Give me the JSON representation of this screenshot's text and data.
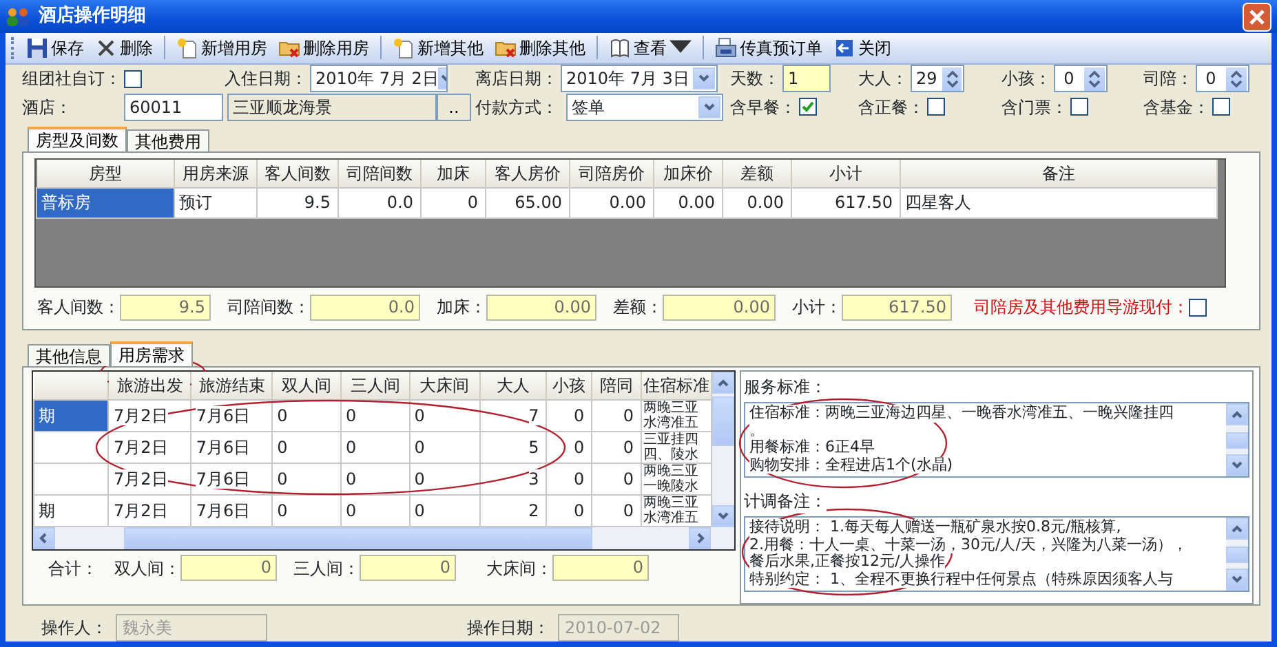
{
  "window": {
    "title": "酒店操作明细"
  },
  "toolbar": [
    [
      {
        "kind": "save",
        "label": "保存"
      },
      {
        "kind": "delete",
        "label": "删除"
      }
    ],
    [
      {
        "kind": "new",
        "label": "新增用房"
      },
      {
        "kind": "remove",
        "label": "删除用房"
      }
    ],
    [
      {
        "kind": "new",
        "label": "新增其他"
      },
      {
        "kind": "remove",
        "label": "删除其他"
      }
    ],
    [
      {
        "kind": "menu",
        "label": "查看"
      }
    ],
    [
      {
        "kind": "fax",
        "label": "传真预订单"
      },
      {
        "kind": "close",
        "label": "关闭"
      }
    ]
  ],
  "form_rows": [
    [
      {
        "kind": "checkbox",
        "label": "组团社自订：",
        "checked": false
      },
      {
        "kind": "date",
        "label": "入住日期：",
        "value": "2010年 7月 2日"
      },
      {
        "kind": "date",
        "label": "离店日期：",
        "value": "2010年 7月 3日"
      },
      {
        "kind": "yellow",
        "label": "天数：",
        "value": "1"
      },
      {
        "kind": "spin",
        "label": "大人：",
        "value": "29"
      },
      {
        "kind": "spin",
        "label": "小孩：",
        "value": "0"
      },
      {
        "kind": "spin",
        "label": "司陪：",
        "value": "0"
      }
    ],
    [
      {
        "kind": "lookup",
        "label": "酒店：",
        "value": "60011",
        "name": "三亚顺龙海景",
        "button": ".."
      },
      {
        "kind": "select",
        "label": "付款方式：",
        "value": "签单"
      },
      {
        "kind": "checkbox",
        "label": "含早餐：",
        "checked": true
      },
      {
        "kind": "checkbox",
        "label": "含正餐：",
        "checked": false
      },
      {
        "kind": "checkbox",
        "label": "含门票：",
        "checked": false
      },
      {
        "kind": "checkbox",
        "label": "含基金：",
        "checked": false
      }
    ]
  ],
  "upper_tabs": [
    {
      "label": "房型及间数",
      "selected": true
    },
    {
      "label": "其他费用",
      "selected": false
    }
  ],
  "rooms_table": {
    "columns": [
      {
        "label": "房型",
        "kind": "text"
      },
      {
        "label": "用房来源",
        "kind": "text"
      },
      {
        "label": "客人间数",
        "kind": "number"
      },
      {
        "label": "司陪间数",
        "kind": "number"
      },
      {
        "label": "加床",
        "kind": "number"
      },
      {
        "label": "客人房价",
        "kind": "number"
      },
      {
        "label": "司陪房价",
        "kind": "number"
      },
      {
        "label": "加床价",
        "kind": "number"
      },
      {
        "label": "差额",
        "kind": "number"
      },
      {
        "label": "小计",
        "kind": "number"
      },
      {
        "label": "备注",
        "kind": "text"
      }
    ],
    "rows": [
      {
        "selected": true,
        "cells": [
          "普标房",
          "预订",
          "9.5",
          "0.0",
          "0",
          "65.00",
          "0.00",
          "0.00",
          "0.00",
          "617.50",
          "四星客人"
        ]
      }
    ]
  },
  "room_summary": {
    "fields": [
      {
        "label": "客人间数：",
        "value": "9.5"
      },
      {
        "label": "司陪间数：",
        "value": "0.0"
      },
      {
        "label": "加床：",
        "value": "0.00"
      },
      {
        "label": "差额：",
        "value": "0.00"
      },
      {
        "label": "小计：",
        "value": "617.50"
      }
    ],
    "guide_pays": {
      "label": "司陪房及其他费用导游现付：",
      "checked": false
    }
  },
  "lower_tabs": [
    {
      "label": "其他信息",
      "selected": false
    },
    {
      "label": "用房需求",
      "selected": true
    }
  ],
  "demand_table": {
    "columns": [
      {
        "label": "旅游出发",
        "kind": "text"
      },
      {
        "label": "旅游结束",
        "kind": "text"
      },
      {
        "label": "双人间",
        "kind": "text"
      },
      {
        "label": "三人间",
        "kind": "text"
      },
      {
        "label": "大床间",
        "kind": "text"
      },
      {
        "label": "大人",
        "kind": "number"
      },
      {
        "label": "小孩",
        "kind": "number"
      },
      {
        "label": "陪同",
        "kind": "number"
      },
      {
        "label": "住宿标准",
        "kind": "wrap"
      }
    ],
    "rows": [
      {
        "selected": true,
        "row_label": "期",
        "cells": [
          "7月2日",
          "7月6日",
          "0",
          "0",
          "0",
          "7",
          "0",
          "0",
          "两晚三亚水湾准五"
        ]
      },
      {
        "selected": false,
        "cells": [
          "7月2日",
          "7月6日",
          "0",
          "0",
          "0",
          "5",
          "0",
          "0",
          "三亚挂四四、陵水"
        ]
      },
      {
        "selected": false,
        "cells": [
          "7月2日",
          "7月6日",
          "0",
          "0",
          "0",
          "3",
          "0",
          "0",
          "两晚三亚一晚陵水"
        ]
      },
      {
        "selected": false,
        "row_label": "期",
        "cells": [
          "7月2日",
          "7月6日",
          "0",
          "0",
          "0",
          "2",
          "0",
          "0",
          "两晚三亚水湾准五"
        ]
      }
    ]
  },
  "totals": {
    "label": "合计：",
    "fields": [
      {
        "label": "双人间：",
        "value": "0"
      },
      {
        "label": "三人间：",
        "value": "0"
      },
      {
        "label": "大床间：",
        "value": "0"
      }
    ]
  },
  "service_standard": {
    "label": "服务标准：",
    "lines": [
      "住宿标准：两晚三亚海边四星、一晚香水湾准五、一晚兴隆挂四",
      "。",
      "用餐标准：6正4早",
      "购物安排：全程进店1个(水晶)"
    ]
  },
  "planner_notes": {
    "label": "计调备注：",
    "lines": [
      "接待说明： 1.每天每人赠送一瓶矿泉水按0.8元/瓶核算,",
      "2.用餐：十人一桌、十菜一汤，30元/人/天，兴隆为八菜一汤），",
      "餐后水果,正餐按12元/人操作",
      "特别约定： 1、全程不更换行程中任何景点（特殊原因须客人与"
    ]
  },
  "footer": [
    {
      "label": "操作人：",
      "value": "魏永美"
    },
    {
      "label": "操作日期：",
      "value": "2010-07-02"
    }
  ],
  "annotations": [
    {
      "kind": "ellipse"
    },
    {
      "kind": "ellipse"
    },
    {
      "kind": "ellipse"
    },
    {
      "kind": "ellipse"
    }
  ]
}
